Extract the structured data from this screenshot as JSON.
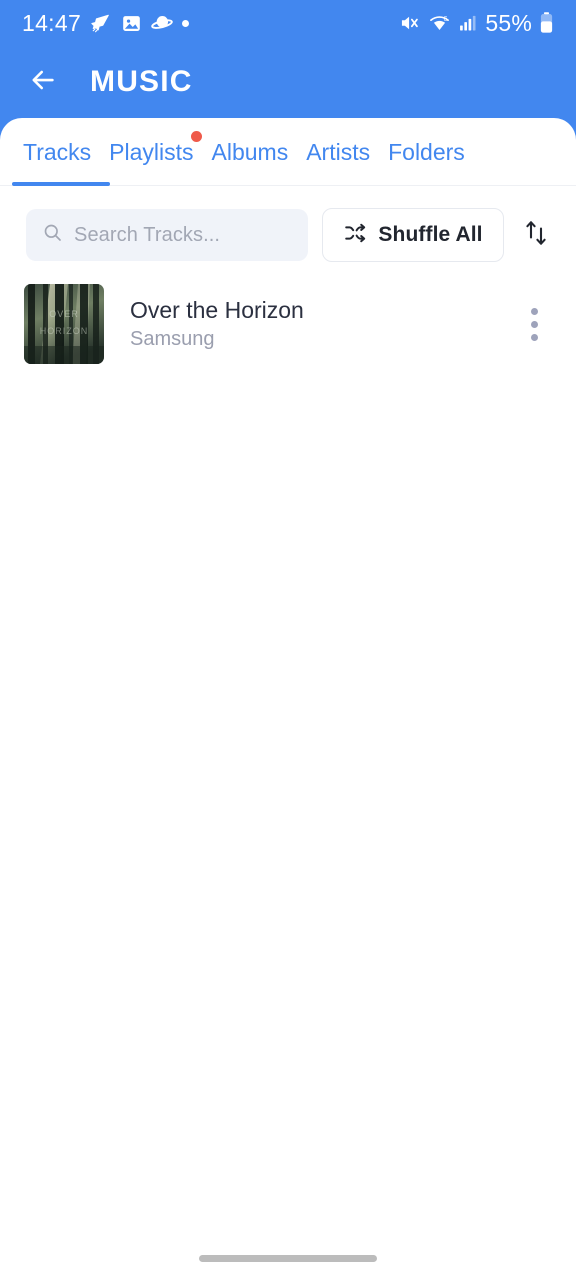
{
  "colors": {
    "brand_blue": "#4287ef",
    "badge_red": "#ef5a4a",
    "title_text": "#2b3040",
    "muted_text": "#9a9eae",
    "search_bg": "#f0f3f9"
  },
  "statusbar": {
    "clock": "14:47",
    "battery_percent": "55%",
    "left_icons": [
      "shooting-star-icon",
      "image-icon",
      "planet-icon",
      "dot-icon"
    ],
    "right_icons": [
      "mute-icon",
      "wifi-icon",
      "cellular-signal-icon",
      "battery-icon"
    ]
  },
  "appbar": {
    "back_icon": "back-arrow-icon",
    "title": "MUSIC"
  },
  "tabs": [
    {
      "label": "Tracks",
      "active": true,
      "badge": false
    },
    {
      "label": "Playlists",
      "active": false,
      "badge": true
    },
    {
      "label": "Albums",
      "active": false,
      "badge": false
    },
    {
      "label": "Artists",
      "active": false,
      "badge": false
    },
    {
      "label": "Folders",
      "active": false,
      "badge": false
    }
  ],
  "toolbar": {
    "search_placeholder": "Search Tracks...",
    "search_value": "",
    "search_icon": "search-icon",
    "shuffle_label": "Shuffle All",
    "shuffle_icon": "shuffle-icon",
    "sort_icon": "sort-arrows-icon"
  },
  "tracks": [
    {
      "title": "Over the Horizon",
      "artist": "Samsung",
      "artwork": "forest-album-art",
      "menu_icon": "more-vertical-icon"
    }
  ],
  "navigation": {
    "home_indicator": "home-indicator"
  }
}
